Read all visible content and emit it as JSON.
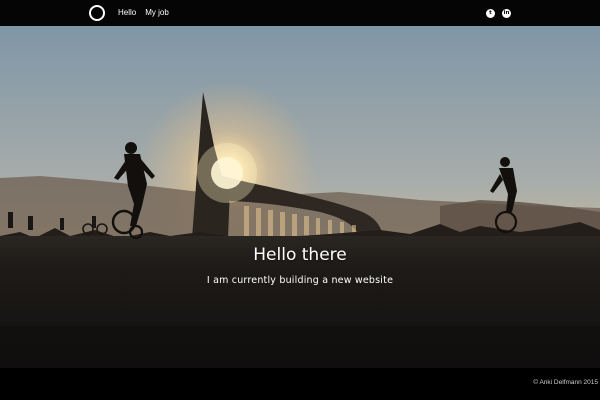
{
  "nav": {
    "items": [
      {
        "label": "Hello"
      },
      {
        "label": "My job"
      }
    ]
  },
  "social": {
    "twitter_glyph": "t",
    "linkedin_glyph": "in"
  },
  "hero": {
    "title": "Hello there",
    "subtitle": "I am currently building a new website"
  },
  "footer": {
    "copyright": "© Anki Delfmann 2015"
  },
  "colors": {
    "topbar": "#050505",
    "sky_top": "#7f96a6",
    "sky_horizon": "#d9c39a",
    "ground": "#161412"
  }
}
